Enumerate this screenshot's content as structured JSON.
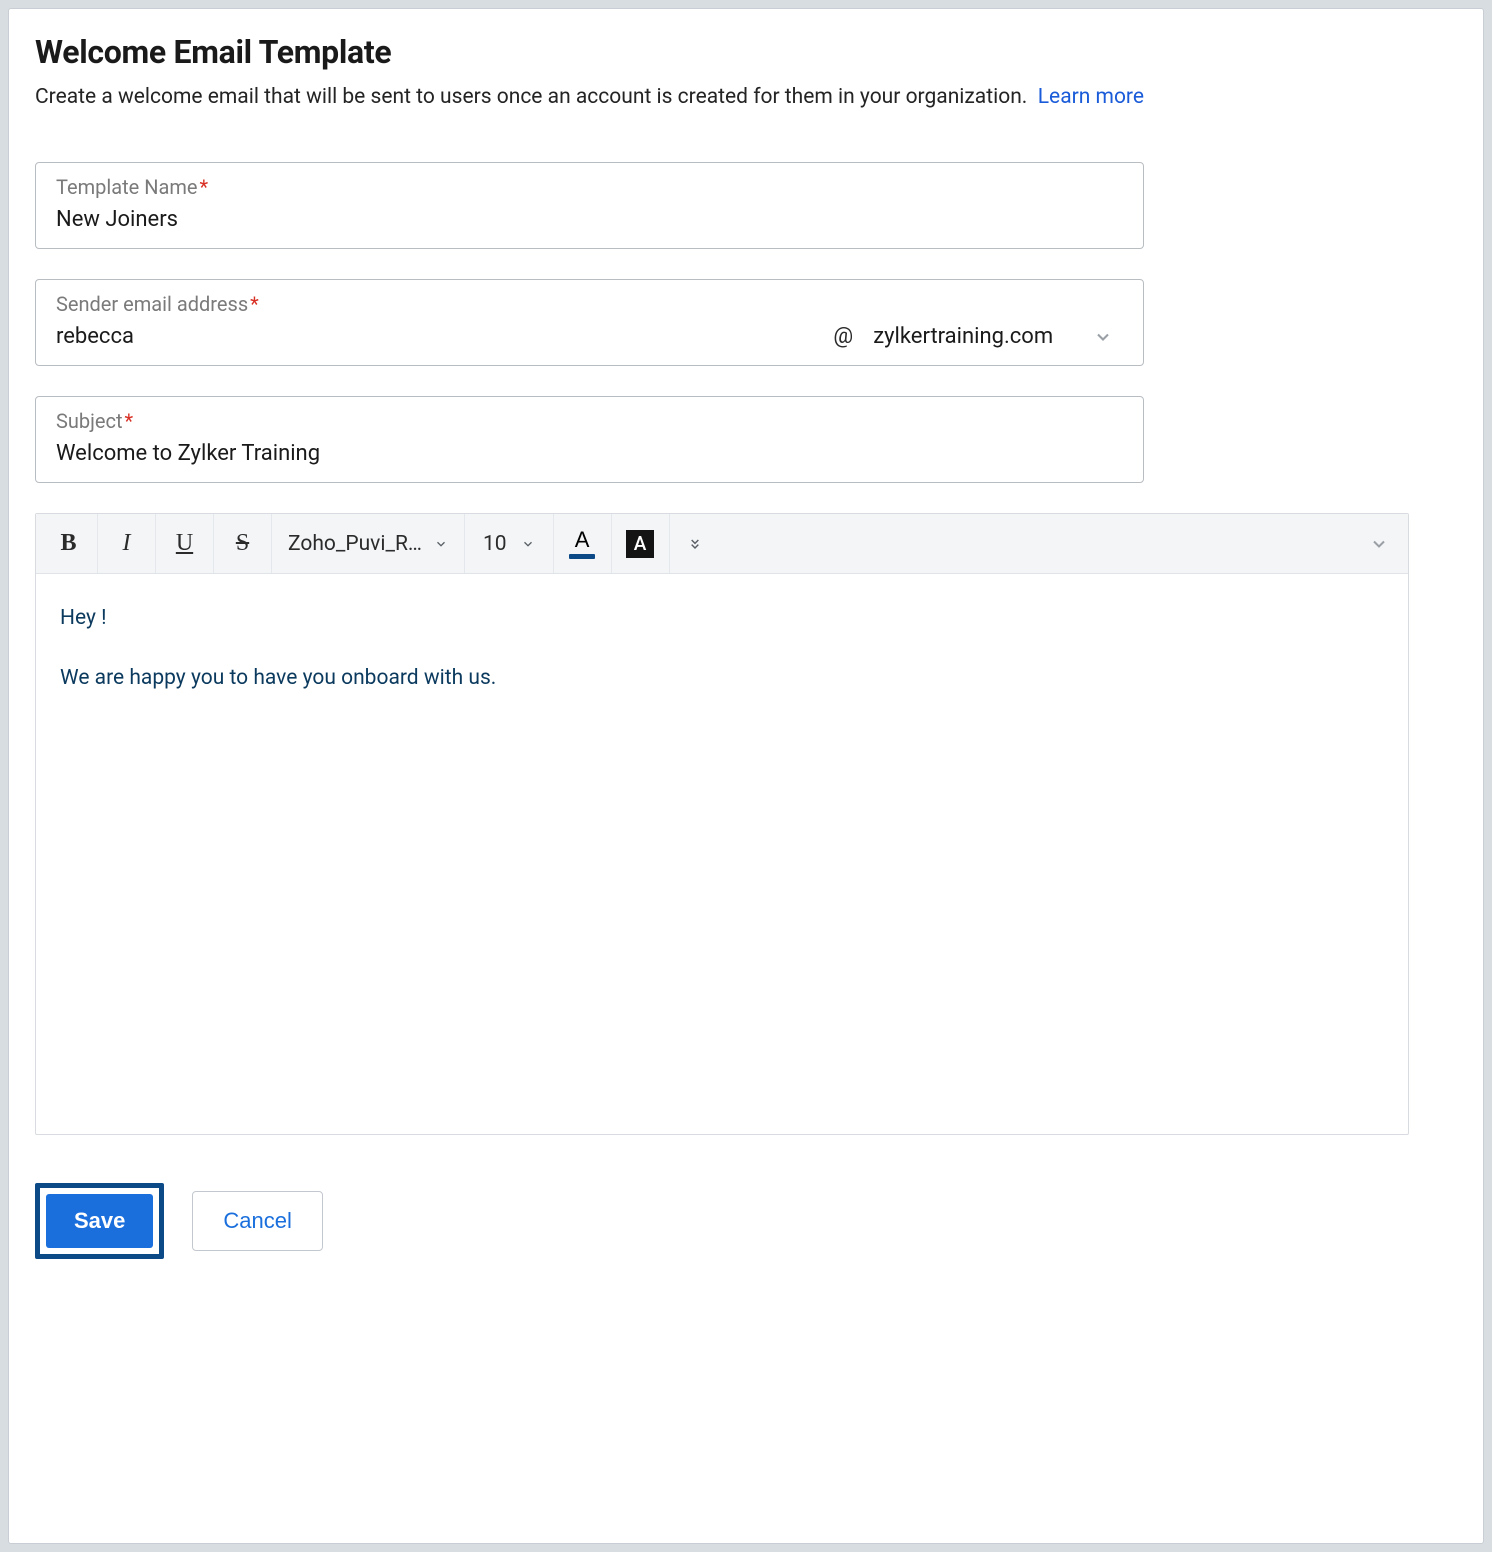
{
  "header": {
    "title": "Welcome Email Template",
    "description": "Create a welcome email that will be sent to users once an account is created for them in your organization.",
    "learn_more": "Learn more"
  },
  "fields": {
    "template_name": {
      "label": "Template Name",
      "value": "New Joiners"
    },
    "sender": {
      "label": "Sender email address",
      "local": "rebecca",
      "at": "@",
      "domain": "zylkertraining.com"
    },
    "subject": {
      "label": "Subject",
      "value": "Welcome to Zylker Training"
    }
  },
  "editor": {
    "toolbar": {
      "font_family": "Zoho_Puvi_R…",
      "font_size": "10",
      "textcolor_letter": "A",
      "bgcolor_letter": "A"
    },
    "body": {
      "line1": "Hey !",
      "line2": "We are happy you to have you onboard with us."
    }
  },
  "buttons": {
    "save": "Save",
    "cancel": "Cancel"
  }
}
